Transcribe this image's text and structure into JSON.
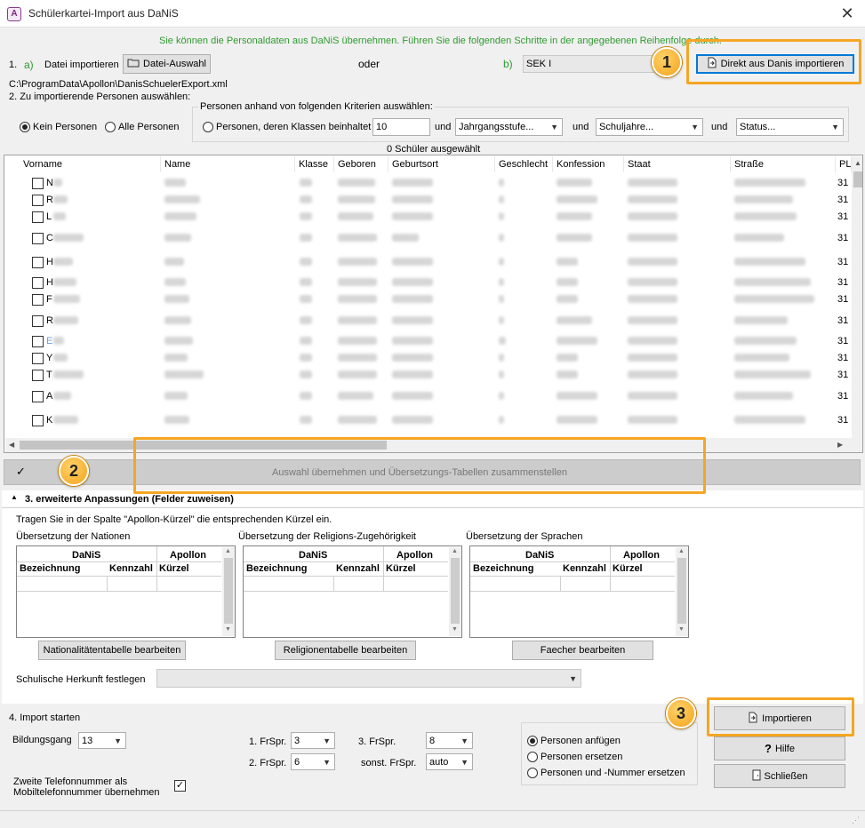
{
  "window": {
    "title": "Schülerkartei-Import aus DaNiS",
    "close": "✕"
  },
  "instruction": "Sie können die Personaldaten aus DaNiS übernehmen. Führen Sie die folgenden Schritte in der angegebenen Reihenfolge durch.",
  "step1": {
    "label": "1.",
    "a_label": "a)",
    "import_label": "Datei importieren",
    "file_button": "Datei-Auswahl",
    "or_label": "oder",
    "b_label": "b)",
    "school_select": "SEK I",
    "direct_button": "Direkt aus Danis importieren",
    "file_path": "C:\\ProgramData\\Apollon\\DanisSchuelerExport.xml"
  },
  "step2": {
    "label": "2. Zu importierende Personen auswählen:",
    "radio_none": "Kein Personen",
    "radio_all": "Alle Personen",
    "criteria_title": "Personen anhand von folgenden Kriterien auswählen:",
    "radio_classes": "Personen, deren Klassen beinhaltet",
    "class_value": "10",
    "and1": "und",
    "grade_select": "Jahrgangsstufe...",
    "and2": "und",
    "year_select": "Schuljahre...",
    "and3": "und",
    "status_select": "Status...",
    "selected_count": "0 Schüler ausgewählt"
  },
  "grid": {
    "columns": [
      "Vorname",
      "Name",
      "Klasse",
      "Geboren",
      "Geburtsort",
      "Geschlecht",
      "Konfession",
      "Staat",
      "Straße",
      "PL"
    ],
    "rows": [
      {
        "first": "N",
        "pl": "31"
      },
      {
        "first": "R",
        "pl": "31"
      },
      {
        "first": "L",
        "pl": "31"
      },
      {
        "first": "C",
        "pl": "31"
      },
      {
        "first": "H",
        "pl": "31"
      },
      {
        "first": "H",
        "pl": "31"
      },
      {
        "first": "F",
        "pl": "31"
      },
      {
        "first": "R",
        "pl": "31"
      },
      {
        "first": "E",
        "pl": "31"
      },
      {
        "first": "Y",
        "pl": "31"
      },
      {
        "first": "T",
        "pl": "31"
      },
      {
        "first": "A",
        "pl": "31"
      },
      {
        "first": "K",
        "pl": "31"
      }
    ]
  },
  "apply_bar": {
    "check": "✓",
    "button": "Auswahl übernehmen und Übersetzungs-Tabellen zusammenstellen"
  },
  "step3": {
    "title": "3. erweiterte Anpassungen (Felder zuweisen)",
    "hint": "Tragen Sie in der Spalte \"Apollon-Kürzel\" die entsprechenden Kürzel ein.",
    "tables": [
      {
        "title": "Übersetzung der Nationen",
        "danis": "DaNiS",
        "apollon": "Apollon",
        "c1": "Bezeichnung",
        "c2": "Kennzahl",
        "c3": "Kürzel",
        "button": "Nationalitätentabelle bearbeiten"
      },
      {
        "title": "Übersetzung der Religions-Zugehörigkeit",
        "danis": "DaNiS",
        "apollon": "Apollon",
        "c1": "Bezeichnung",
        "c2": "Kennzahl",
        "c3": "Kürzel",
        "button": "Religionentabelle bearbeiten"
      },
      {
        "title": "Übersetzung der Sprachen",
        "danis": "DaNiS",
        "apollon": "Apollon",
        "c1": "Bezeichnung",
        "c2": "Kennzahl",
        "c3": "Kürzel",
        "button": "Faecher bearbeiten"
      }
    ],
    "origin_label": "Schulische Herkunft festlegen",
    "origin_value": ""
  },
  "step4": {
    "title": "4. Import starten",
    "bildungsgang_label": "Bildungsgang",
    "bildungsgang_value": "13",
    "fr1_label": "1. FrSpr.",
    "fr1_value": "3",
    "fr2_label": "2. FrSpr.",
    "fr2_value": "6",
    "fr3_label": "3. FrSpr.",
    "fr3_value": "8",
    "frs_label": "sonst. FrSpr.",
    "frs_value": "auto",
    "phone_label": "Zweite Telefonnummer als Mobiltelefonnummer übernehmen",
    "phone_checked": "✓",
    "radio_append": "Personen anfügen",
    "radio_replace": "Personen ersetzen",
    "radio_replace_num": "Personen und -Nummer ersetzen"
  },
  "buttons": {
    "import": "Importieren",
    "help": "Hilfe",
    "close": "Schließen"
  },
  "callouts": {
    "one": "1",
    "two": "2",
    "three": "3"
  },
  "colors": {
    "instruction": "#2f9a2f",
    "callout": "#f5a623",
    "default_border": "#0078d7"
  }
}
